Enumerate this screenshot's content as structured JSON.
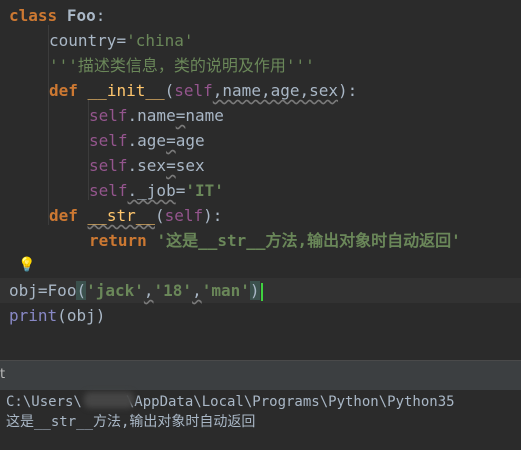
{
  "editor": {
    "line1": {
      "kw": "class",
      "name": "Foo",
      "colon": ":"
    },
    "line2": {
      "var": "country",
      "eq": "=",
      "value": "'china'"
    },
    "line3": {
      "doc": "'''描述类信息，类的说明及作用'''"
    },
    "line4": {
      "kw": "def",
      "fn": "__init__",
      "open": "(",
      "self": "self",
      "params": ",name,age,sex",
      "close": "):"
    },
    "line5": {
      "self": "self",
      "attr": ".name",
      "eq": "=",
      "value": "name"
    },
    "line6": {
      "self": "self",
      "attr": ".age",
      "eq": "=",
      "value": "age"
    },
    "line7": {
      "self": "self",
      "attr": ".sex",
      "eq": "=",
      "value": "sex"
    },
    "line8": {
      "self": "self",
      "attr": "._job",
      "eq": "=",
      "value": "'IT'"
    },
    "line9": {
      "kw": "def",
      "fn": "__str__",
      "open": "(",
      "self": "self",
      "close": "):"
    },
    "line10": {
      "kw": "return",
      "value": "'这是__str__方法,输出对象时自动返回'"
    },
    "line12": {
      "obj": "obj",
      "eq": "=",
      "cls": "Foo",
      "open": "(",
      "a1": "'jack'",
      "c1": ",",
      "a2": "'18'",
      "c2": ",",
      "a3": "'man'",
      "close": ")"
    },
    "line13": {
      "fn": "print",
      "open": "(",
      "arg": "obj",
      "close": ")"
    },
    "lightbulb": "lightbulb-icon"
  },
  "run_panel": {
    "label": "t"
  },
  "console": {
    "path_line": "C:\\Users\\",
    "path_rest": "\\AppData\\Local\\Programs\\Python\\Python35",
    "output_line": "这是__str__方法,输出对象时自动返回"
  },
  "colors": {
    "background": "#2b2b2b",
    "keyword": "#cc7832",
    "function": "#ffc66d",
    "self": "#94558d",
    "string": "#6a8759",
    "text": "#a9b7c6",
    "caret": "#3fd23f"
  }
}
